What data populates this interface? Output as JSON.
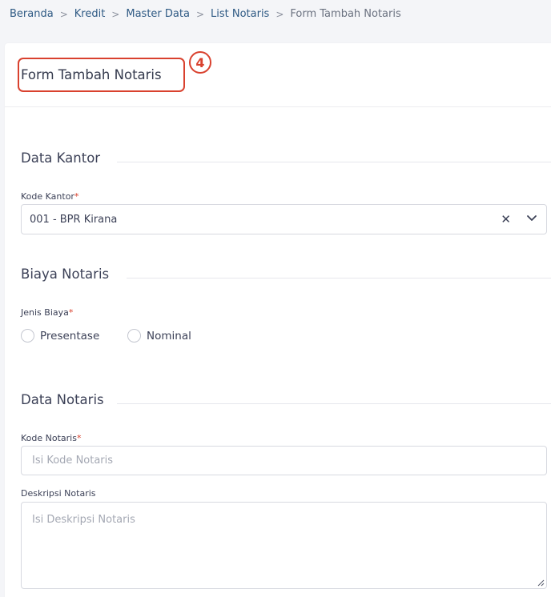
{
  "breadcrumb": {
    "items": [
      "Beranda",
      "Kredit",
      "Master Data",
      "List Notaris"
    ],
    "current": "Form Tambah Notaris",
    "separator": ">"
  },
  "form": {
    "title": "Form Tambah Notaris",
    "marker": "4",
    "sections": {
      "data_kantor": {
        "title": "Data Kantor",
        "kode_kantor_label": "Kode Kantor",
        "kode_kantor_value": "001 - BPR Kirana"
      },
      "biaya_notaris": {
        "title": "Biaya Notaris",
        "jenis_biaya_label": "Jenis Biaya",
        "options": [
          "Presentase",
          "Nominal"
        ]
      },
      "data_notaris": {
        "title": "Data Notaris",
        "kode_notaris_label": "Kode Notaris",
        "kode_notaris_placeholder": "Isi Kode Notaris",
        "deskripsi_label": "Deskripsi Notaris",
        "deskripsi_placeholder": "Isi Deskripsi Notaris"
      }
    },
    "required_mark": "*"
  },
  "colors": {
    "accent_red": "#d9412e",
    "link_blue": "#2f5a84",
    "text_dark": "#3c4157",
    "border": "#d7d9e0"
  },
  "icons": {
    "clear": "close-icon",
    "dropdown": "chevron-down-icon",
    "resize": "resize-handle-icon"
  }
}
